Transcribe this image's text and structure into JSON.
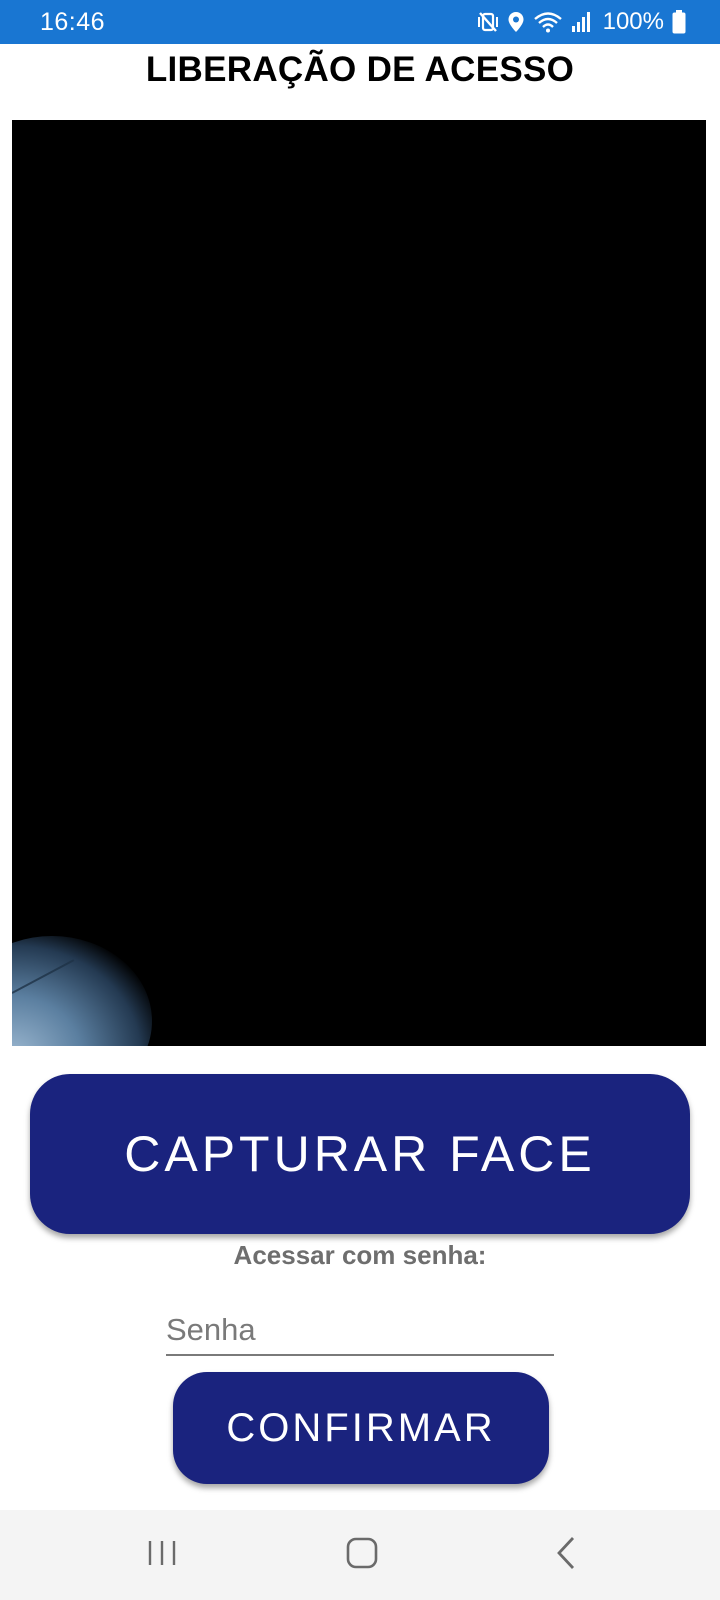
{
  "status_bar": {
    "time": "16:46",
    "battery": "100%",
    "icons": [
      "mute-vibrate-icon",
      "location-icon",
      "wifi-icon",
      "signal-icon",
      "battery-icon"
    ],
    "background_color": "#1976d2"
  },
  "header": {
    "title": "LIBERAÇÃO DE ACESSO"
  },
  "camera": {
    "background_color": "#000000"
  },
  "capture": {
    "label": "CAPTURAR FACE"
  },
  "password": {
    "label": "Acessar com senha:",
    "placeholder": "Senha",
    "value": ""
  },
  "confirm": {
    "label": "CONFIRMAR"
  },
  "nav_bar": {
    "buttons": [
      "recents-icon",
      "home-icon",
      "back-icon"
    ]
  },
  "colors": {
    "primary_button": "#1a237e",
    "label_gray": "#6e6e6e"
  }
}
